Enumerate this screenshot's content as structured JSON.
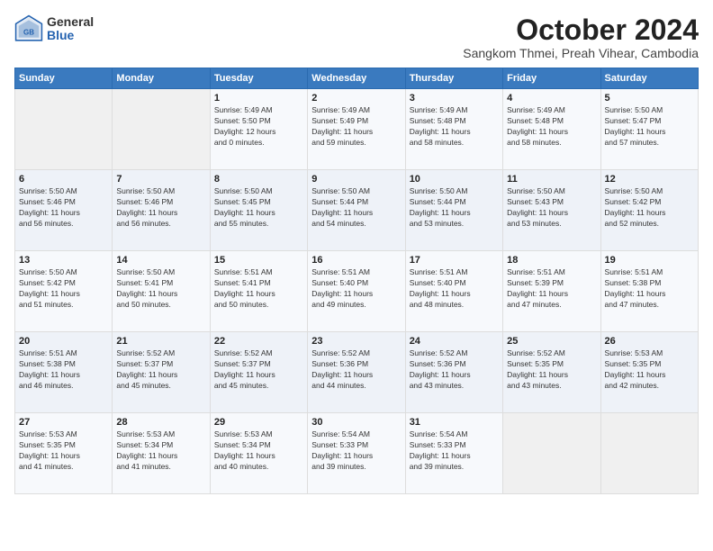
{
  "logo": {
    "general": "General",
    "blue": "Blue"
  },
  "header": {
    "title": "October 2024",
    "subtitle": "Sangkom Thmei, Preah Vihear, Cambodia"
  },
  "weekdays": [
    "Sunday",
    "Monday",
    "Tuesday",
    "Wednesday",
    "Thursday",
    "Friday",
    "Saturday"
  ],
  "weeks": [
    [
      {
        "day": "",
        "info": ""
      },
      {
        "day": "",
        "info": ""
      },
      {
        "day": "1",
        "info": "Sunrise: 5:49 AM\nSunset: 5:50 PM\nDaylight: 12 hours\nand 0 minutes."
      },
      {
        "day": "2",
        "info": "Sunrise: 5:49 AM\nSunset: 5:49 PM\nDaylight: 11 hours\nand 59 minutes."
      },
      {
        "day": "3",
        "info": "Sunrise: 5:49 AM\nSunset: 5:48 PM\nDaylight: 11 hours\nand 58 minutes."
      },
      {
        "day": "4",
        "info": "Sunrise: 5:49 AM\nSunset: 5:48 PM\nDaylight: 11 hours\nand 58 minutes."
      },
      {
        "day": "5",
        "info": "Sunrise: 5:50 AM\nSunset: 5:47 PM\nDaylight: 11 hours\nand 57 minutes."
      }
    ],
    [
      {
        "day": "6",
        "info": "Sunrise: 5:50 AM\nSunset: 5:46 PM\nDaylight: 11 hours\nand 56 minutes."
      },
      {
        "day": "7",
        "info": "Sunrise: 5:50 AM\nSunset: 5:46 PM\nDaylight: 11 hours\nand 56 minutes."
      },
      {
        "day": "8",
        "info": "Sunrise: 5:50 AM\nSunset: 5:45 PM\nDaylight: 11 hours\nand 55 minutes."
      },
      {
        "day": "9",
        "info": "Sunrise: 5:50 AM\nSunset: 5:44 PM\nDaylight: 11 hours\nand 54 minutes."
      },
      {
        "day": "10",
        "info": "Sunrise: 5:50 AM\nSunset: 5:44 PM\nDaylight: 11 hours\nand 53 minutes."
      },
      {
        "day": "11",
        "info": "Sunrise: 5:50 AM\nSunset: 5:43 PM\nDaylight: 11 hours\nand 53 minutes."
      },
      {
        "day": "12",
        "info": "Sunrise: 5:50 AM\nSunset: 5:42 PM\nDaylight: 11 hours\nand 52 minutes."
      }
    ],
    [
      {
        "day": "13",
        "info": "Sunrise: 5:50 AM\nSunset: 5:42 PM\nDaylight: 11 hours\nand 51 minutes."
      },
      {
        "day": "14",
        "info": "Sunrise: 5:50 AM\nSunset: 5:41 PM\nDaylight: 11 hours\nand 50 minutes."
      },
      {
        "day": "15",
        "info": "Sunrise: 5:51 AM\nSunset: 5:41 PM\nDaylight: 11 hours\nand 50 minutes."
      },
      {
        "day": "16",
        "info": "Sunrise: 5:51 AM\nSunset: 5:40 PM\nDaylight: 11 hours\nand 49 minutes."
      },
      {
        "day": "17",
        "info": "Sunrise: 5:51 AM\nSunset: 5:40 PM\nDaylight: 11 hours\nand 48 minutes."
      },
      {
        "day": "18",
        "info": "Sunrise: 5:51 AM\nSunset: 5:39 PM\nDaylight: 11 hours\nand 47 minutes."
      },
      {
        "day": "19",
        "info": "Sunrise: 5:51 AM\nSunset: 5:38 PM\nDaylight: 11 hours\nand 47 minutes."
      }
    ],
    [
      {
        "day": "20",
        "info": "Sunrise: 5:51 AM\nSunset: 5:38 PM\nDaylight: 11 hours\nand 46 minutes."
      },
      {
        "day": "21",
        "info": "Sunrise: 5:52 AM\nSunset: 5:37 PM\nDaylight: 11 hours\nand 45 minutes."
      },
      {
        "day": "22",
        "info": "Sunrise: 5:52 AM\nSunset: 5:37 PM\nDaylight: 11 hours\nand 45 minutes."
      },
      {
        "day": "23",
        "info": "Sunrise: 5:52 AM\nSunset: 5:36 PM\nDaylight: 11 hours\nand 44 minutes."
      },
      {
        "day": "24",
        "info": "Sunrise: 5:52 AM\nSunset: 5:36 PM\nDaylight: 11 hours\nand 43 minutes."
      },
      {
        "day": "25",
        "info": "Sunrise: 5:52 AM\nSunset: 5:35 PM\nDaylight: 11 hours\nand 43 minutes."
      },
      {
        "day": "26",
        "info": "Sunrise: 5:53 AM\nSunset: 5:35 PM\nDaylight: 11 hours\nand 42 minutes."
      }
    ],
    [
      {
        "day": "27",
        "info": "Sunrise: 5:53 AM\nSunset: 5:35 PM\nDaylight: 11 hours\nand 41 minutes."
      },
      {
        "day": "28",
        "info": "Sunrise: 5:53 AM\nSunset: 5:34 PM\nDaylight: 11 hours\nand 41 minutes."
      },
      {
        "day": "29",
        "info": "Sunrise: 5:53 AM\nSunset: 5:34 PM\nDaylight: 11 hours\nand 40 minutes."
      },
      {
        "day": "30",
        "info": "Sunrise: 5:54 AM\nSunset: 5:33 PM\nDaylight: 11 hours\nand 39 minutes."
      },
      {
        "day": "31",
        "info": "Sunrise: 5:54 AM\nSunset: 5:33 PM\nDaylight: 11 hours\nand 39 minutes."
      },
      {
        "day": "",
        "info": ""
      },
      {
        "day": "",
        "info": ""
      }
    ]
  ]
}
